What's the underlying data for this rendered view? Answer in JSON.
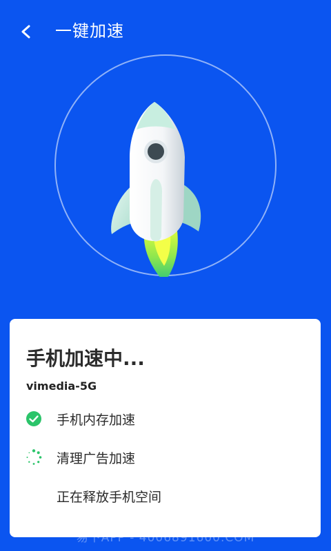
{
  "header": {
    "title": "一键加速"
  },
  "card": {
    "title": "手机加速中...",
    "network": "vimedia-5G",
    "steps": [
      {
        "label": "手机内存加速",
        "status": "done"
      },
      {
        "label": "清理广告加速",
        "status": "loading"
      },
      {
        "label": "正在释放手机空间",
        "status": "pending"
      }
    ]
  },
  "watermark": "易下APP - 4006891600.COM",
  "colors": {
    "background": "#0b55f0",
    "success": "#2bc46a",
    "loading": "#2bc46a"
  }
}
